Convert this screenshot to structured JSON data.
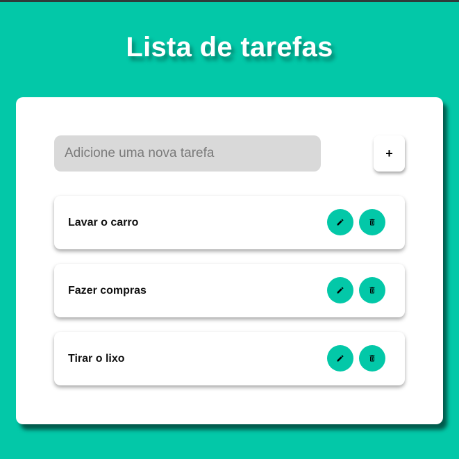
{
  "header": {
    "title": "Lista de tarefas"
  },
  "form": {
    "placeholder": "Adicione uma nova tarefa",
    "value": "",
    "add_label": "+"
  },
  "tasks": [
    {
      "label": "Lavar o carro",
      "edit_icon": "pencil-icon",
      "delete_icon": "trash-icon"
    },
    {
      "label": "Fazer compras",
      "edit_icon": "pencil-icon",
      "delete_icon": "trash-icon"
    },
    {
      "label": "Tirar o lixo",
      "edit_icon": "pencil-icon",
      "delete_icon": "trash-icon"
    }
  ],
  "colors": {
    "accent": "#03c8a8",
    "card": "#ffffff",
    "input_bg": "#d9d9d9",
    "top_bar": "#2f3b3a"
  }
}
